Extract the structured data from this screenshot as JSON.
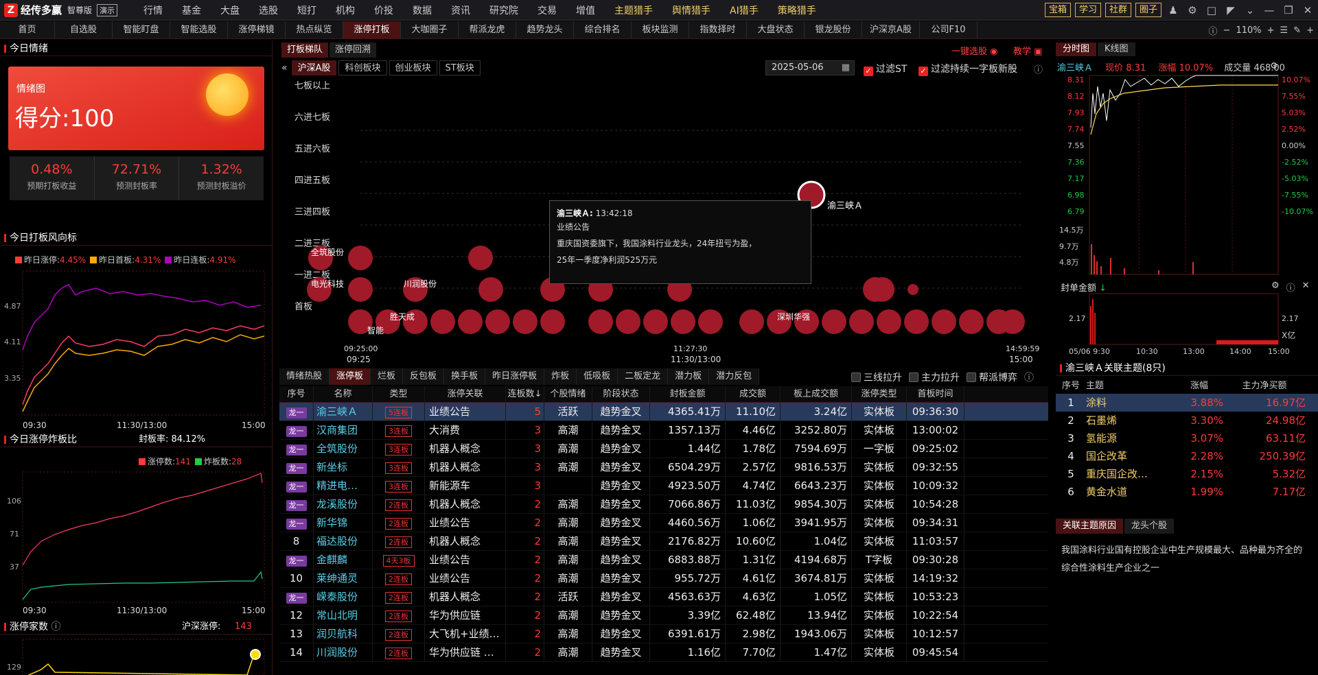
{
  "app": {
    "logo": "经传多赢",
    "edition": "智尊版",
    "demo": "演示"
  },
  "menu": [
    {
      "label": "行情",
      "gold": false
    },
    {
      "label": "基金",
      "gold": false
    },
    {
      "label": "大盘",
      "gold": false
    },
    {
      "label": "选股",
      "gold": false
    },
    {
      "label": "短打",
      "gold": false
    },
    {
      "label": "机构",
      "gold": false
    },
    {
      "label": "价投",
      "gold": false
    },
    {
      "label": "数据",
      "gold": false
    },
    {
      "label": "资讯",
      "gold": false
    },
    {
      "label": "研究院",
      "gold": false
    },
    {
      "label": "交易",
      "gold": false
    },
    {
      "label": "增值",
      "gold": false
    },
    {
      "label": "主题猎手",
      "gold": true
    },
    {
      "label": "舆情猎手",
      "gold": true
    },
    {
      "label": "AI猎手",
      "gold": true
    },
    {
      "label": "策略猎手",
      "gold": true
    }
  ],
  "top_buttons": [
    "宝箱",
    "学习",
    "社群",
    "圈子"
  ],
  "tabs": [
    "首页",
    "自选股",
    "智能盯盘",
    "智能选股",
    "涨停梯镜",
    "热点纵览",
    "涨停打板",
    "大咖圈子",
    "帮派龙虎",
    "趋势龙头",
    "综合排名",
    "板块监测",
    "指数择时",
    "大盘状态",
    "银龙股份",
    "沪深京A股",
    "公司F10"
  ],
  "active_tab": "涨停打板",
  "zoom": "110%",
  "left": {
    "mood_title": "今日情绪",
    "mood_label": "情绪图",
    "mood_score": "得分:100",
    "stats": [
      {
        "value": "0.48%",
        "label": "预期打板收益"
      },
      {
        "value": "72.71%",
        "label": "预测封板率"
      },
      {
        "value": "1.32%",
        "label": "预测封板溢价"
      }
    ],
    "wind_title": "今日打板风向标",
    "wind_legend": [
      {
        "label": "昨日涨停:",
        "value": "4.45%",
        "color": "#ff3a3a"
      },
      {
        "label": "昨日首板:",
        "value": "4.31%",
        "color": "#ffaa00"
      },
      {
        "label": "昨日连板:",
        "value": "4.91%",
        "color": "#b000c0"
      }
    ],
    "wind_y": [
      "4.87",
      "4.11",
      "3.35"
    ],
    "time_axis": [
      "09:30",
      "11:30/13:00",
      "15:00"
    ],
    "ratio_title": "今日涨停炸板比",
    "ratio_seal": "封板率: 84.12%",
    "ratio_legend": [
      {
        "label": "涨停数:",
        "value": "141",
        "color": "#ff3a3a"
      },
      {
        "label": "炸板数:",
        "value": "28",
        "color": "#22cc44"
      }
    ],
    "ratio_y": [
      "106",
      "71",
      "37"
    ],
    "count_title": "涨停家数",
    "count_label": "沪深涨停:",
    "count_value": "143",
    "count_y": "129"
  },
  "mid": {
    "head_tabs": [
      "打板梯队",
      "涨停回溯"
    ],
    "sub_tabs": [
      "沪深A股",
      "科创板块",
      "创业板块",
      "ST板块"
    ],
    "date": "2025-05-06",
    "filter1": "过滤ST",
    "filter2": "过滤持续一字板新股",
    "quick_select": "一键选股",
    "teach": "教学",
    "levels": [
      "七板以上",
      "六进七板",
      "五进六板",
      "四进五板",
      "三进四板",
      "二进三板",
      "一进二板",
      "首板"
    ],
    "x_axis": [
      "09:25:00",
      "11:27:30",
      "14:59:59"
    ],
    "x_axis2": [
      "09:25",
      "11:30/13:00",
      "15:00"
    ],
    "bubble_labels": [
      {
        "text": "渝三峡Ａ"
      },
      {
        "text": "全筑股份"
      },
      {
        "text": "电光科技"
      },
      {
        "text": "川润股份"
      },
      {
        "text": "深圳华强"
      },
      {
        "text": "胜天成"
      },
      {
        "text": "智能"
      }
    ],
    "tooltip": {
      "title": "渝三峡Ａ:",
      "time": "13:42:18",
      "reason": "业绩公告",
      "text1": "重庆国资委旗下，我国涂料行业龙头，24年扭亏为盈，",
      "text2": "25年一季度净利润525万元"
    },
    "table_tabs": [
      "情绪热股",
      "涨停板",
      "烂板",
      "反包板",
      "换手板",
      "昨日涨停板",
      "炸板",
      "低吸板",
      "二板定龙",
      "潜力板",
      "潜力反包"
    ],
    "table_tab_active": "涨停板",
    "table_filters": [
      "三线拉升",
      "主力拉升",
      "帮派博弈"
    ],
    "columns": [
      "序号",
      "名称",
      "类型",
      "涨停关联",
      "连板数↓",
      "个股情绪",
      "阶段状态",
      "封板金额",
      "成交额",
      "板上成交额",
      "涨停类型",
      "首板时间"
    ],
    "rows": [
      {
        "no": "龙一",
        "name": "渝三峡Ａ",
        "type": "5连板",
        "rel": "业绩公告",
        "cnt": "5",
        "mood": "活跃",
        "stage": "趋势金叉",
        "seal": "4365.41万",
        "amt": "11.10亿",
        "onb": "3.24亿",
        "ztype": "实体板",
        "time": "09:36:30"
      },
      {
        "no": "龙一",
        "name": "汉商集团",
        "type": "3连板",
        "rel": "大消费",
        "cnt": "3",
        "mood": "高潮",
        "stage": "趋势金叉",
        "seal": "1357.13万",
        "amt": "4.46亿",
        "onb": "3252.80万",
        "ztype": "实体板",
        "time": "13:00:02"
      },
      {
        "no": "龙一",
        "name": "全筑股份",
        "type": "3连板",
        "rel": "机器人概念",
        "cnt": "3",
        "mood": "高潮",
        "stage": "趋势金叉",
        "seal": "1.44亿",
        "amt": "1.78亿",
        "onb": "7594.69万",
        "ztype": "一字板",
        "time": "09:25:02"
      },
      {
        "no": "龙一",
        "name": "新坐标",
        "type": "3连板",
        "rel": "机器人概念",
        "cnt": "3",
        "mood": "高潮",
        "stage": "趋势金叉",
        "seal": "6504.29万",
        "amt": "2.57亿",
        "onb": "9816.53万",
        "ztype": "实体板",
        "time": "09:32:55"
      },
      {
        "no": "龙一",
        "name": "精进电…",
        "type": "3连板",
        "rel": "新能源车",
        "cnt": "3",
        "mood": "",
        "stage": "趋势金叉",
        "seal": "4923.50万",
        "amt": "4.74亿",
        "onb": "6643.23万",
        "ztype": "实体板",
        "time": "10:09:32"
      },
      {
        "no": "龙一",
        "name": "龙溪股份",
        "type": "2连板",
        "rel": "机器人概念",
        "cnt": "2",
        "mood": "高潮",
        "stage": "趋势金叉",
        "seal": "7066.86万",
        "amt": "11.03亿",
        "onb": "9854.30万",
        "ztype": "实体板",
        "time": "10:54:28"
      },
      {
        "no": "龙一",
        "name": "新华锦",
        "type": "2连板",
        "rel": "业绩公告",
        "cnt": "2",
        "mood": "高潮",
        "stage": "趋势金叉",
        "seal": "4460.56万",
        "amt": "1.06亿",
        "onb": "3941.95万",
        "ztype": "实体板",
        "time": "09:34:31"
      },
      {
        "no": "8",
        "name": "福达股份",
        "type": "2连板",
        "rel": "机器人概念",
        "cnt": "2",
        "mood": "高潮",
        "stage": "趋势金叉",
        "seal": "2176.82万",
        "amt": "10.60亿",
        "onb": "1.04亿",
        "ztype": "实体板",
        "time": "11:03:57"
      },
      {
        "no": "龙一",
        "name": "金麒麟",
        "type": "4天3板",
        "rel": "业绩公告",
        "cnt": "2",
        "mood": "高潮",
        "stage": "趋势金叉",
        "seal": "6883.88万",
        "amt": "1.31亿",
        "onb": "4194.68万",
        "ztype": "T字板",
        "time": "09:30:28"
      },
      {
        "no": "10",
        "name": "莱绅通灵",
        "type": "2连板",
        "rel": "业绩公告",
        "cnt": "2",
        "mood": "高潮",
        "stage": "趋势金叉",
        "seal": "955.72万",
        "amt": "4.61亿",
        "onb": "3674.81万",
        "ztype": "实体板",
        "time": "14:19:32"
      },
      {
        "no": "龙一",
        "name": "嵘泰股份",
        "type": "2连板",
        "rel": "机器人概念",
        "cnt": "2",
        "mood": "活跃",
        "stage": "趋势金叉",
        "seal": "4563.63万",
        "amt": "4.63亿",
        "onb": "1.05亿",
        "ztype": "实体板",
        "time": "10:53:23"
      },
      {
        "no": "12",
        "name": "常山北明",
        "type": "2连板",
        "rel": "华为供应链",
        "cnt": "2",
        "mood": "高潮",
        "stage": "趋势金叉",
        "seal": "3.39亿",
        "amt": "62.48亿",
        "onb": "13.94亿",
        "ztype": "实体板",
        "time": "10:22:54"
      },
      {
        "no": "13",
        "name": "润贝航科",
        "type": "2连板",
        "rel": "大飞机+业绩…",
        "cnt": "2",
        "mood": "高潮",
        "stage": "趋势金叉",
        "seal": "6391.61万",
        "amt": "2.98亿",
        "onb": "1943.06万",
        "ztype": "实体板",
        "time": "10:12:57"
      },
      {
        "no": "14",
        "name": "川润股份",
        "type": "2连板",
        "rel": "华为供应链 …",
        "cnt": "2",
        "mood": "高潮",
        "stage": "趋势金叉",
        "seal": "1.16亿",
        "amt": "7.70亿",
        "onb": "1.47亿",
        "ztype": "实体板",
        "time": "09:45:54"
      }
    ]
  },
  "right": {
    "tabs": [
      "分时图",
      "K线图"
    ],
    "stock": "渝三峡Ａ",
    "price_label": "现价",
    "price": "8.31",
    "change_label": "涨幅",
    "change": "10.07%",
    "vol_label": "成交量",
    "vol": "468.00",
    "prices": [
      "8.31",
      "8.12",
      "7.93",
      "7.74",
      "7.55",
      "7.36",
      "7.17",
      "6.98",
      "6.79"
    ],
    "pcts": [
      "10.07%",
      "7.55%",
      "5.03%",
      "2.52%",
      "0.00%",
      "-2.52%",
      "-5.03%",
      "-7.55%",
      "-10.07%"
    ],
    "vols": [
      "14.5万",
      "9.7万",
      "4.8万"
    ],
    "seal_title": "封单金额",
    "seal_y": "2.17",
    "seal_unit": "X亿",
    "seal_time": [
      "05/06 9:30",
      "10:30",
      "13:00",
      "14:00",
      "15:00"
    ],
    "theme_title": "渝三峡Ａ关联主题(8只)",
    "theme_cols": [
      "序号",
      "主题",
      "涨幅",
      "主力净买额"
    ],
    "themes": [
      {
        "no": "1",
        "name": "涂料",
        "chg": "3.88%",
        "net": "16.97亿"
      },
      {
        "no": "2",
        "name": "石墨烯",
        "chg": "3.30%",
        "net": "24.98亿"
      },
      {
        "no": "3",
        "name": "氢能源",
        "chg": "3.07%",
        "net": "63.11亿"
      },
      {
        "no": "4",
        "name": "国企改革",
        "chg": "2.28%",
        "net": "250.39亿"
      },
      {
        "no": "5",
        "name": "重庆国企改…",
        "chg": "2.15%",
        "net": "5.32亿"
      },
      {
        "no": "6",
        "name": "黄金水道",
        "chg": "1.99%",
        "net": "7.17亿"
      }
    ],
    "reason_tabs": [
      "关联主题原因",
      "龙头个股"
    ],
    "reason_text": "我国涂料行业国有控股企业中生产规模最大、品种最为齐全的综合性涂料生产企业之一"
  },
  "colors": {
    "accent": "#e8221b",
    "up": "#ff3a3a",
    "down": "#22cc44",
    "gold": "#f2cf6a"
  }
}
